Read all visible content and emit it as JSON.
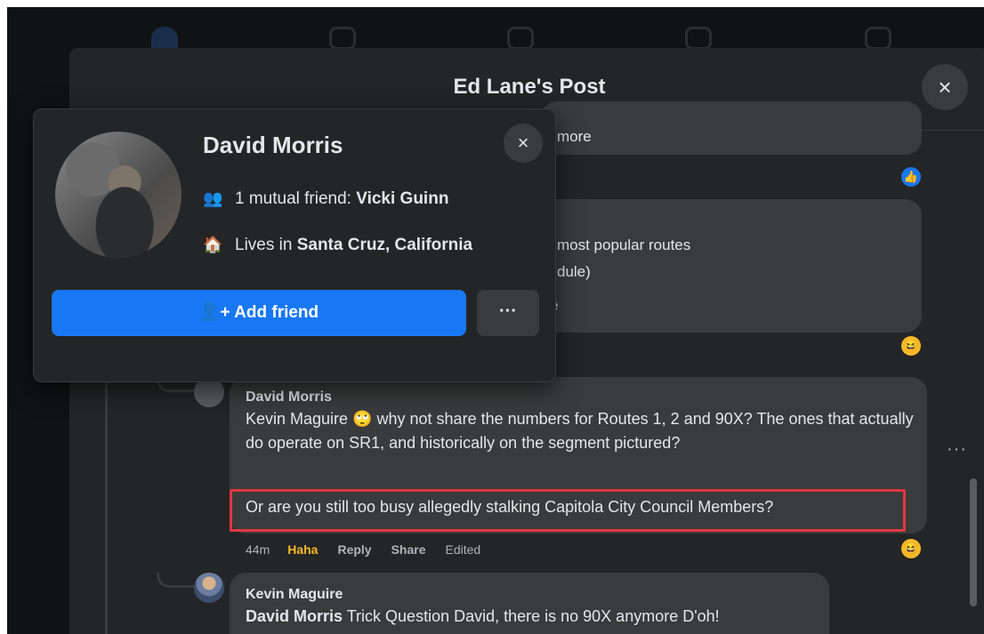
{
  "nav": {
    "icons": [
      "home-icon",
      "video-icon",
      "groups-icon",
      "gaming-icon",
      "marketplace-icon"
    ]
  },
  "dialog": {
    "title": "Ed Lane's Post",
    "close_icon": "×"
  },
  "partial_comments": {
    "fragment_1": "more",
    "fragment_2": "most popular routes",
    "fragment_3": "dule",
    "fragment_3_suffix": ")",
    "fragment_4": "e"
  },
  "reactions": {
    "like_glyph": "👍",
    "haha_glyph": "😆"
  },
  "comments": [
    {
      "author": "David Morris",
      "mention": "Kevin Maguire",
      "emoji": "🙄",
      "text_1": "why not share the numbers for Routes 1, 2 and 90X? The",
      "text_2": "ones that actually do operate on SR1, and historically on the segment",
      "text_3": "pictured?",
      "highlighted_text": "Or are you still too busy allegedly stalking Capitola City Council Members?",
      "time": "44m",
      "reaction_label": "Haha",
      "reply": "Reply",
      "share": "Share",
      "edited": "Edited"
    },
    {
      "author": "Kevin Maguire",
      "mention": "David Morris",
      "text": "Trick Question David, there is no 90X anymore D'oh!"
    }
  ],
  "more_options": "···",
  "hovercard": {
    "name": "David Morris",
    "mutual_prefix": "1 mutual friend: ",
    "mutual_name": "Vicki Guinn",
    "lives_prefix": "Lives in ",
    "lives_place": "Santa Cruz, California",
    "add_friend": "Add friend",
    "more": "···",
    "close_icon": "×"
  },
  "colors": {
    "background": "#242526",
    "bubble": "#3a3b3c",
    "accent": "#1877f2",
    "highlight_border": "#e0373f",
    "haha": "#f7b928"
  }
}
